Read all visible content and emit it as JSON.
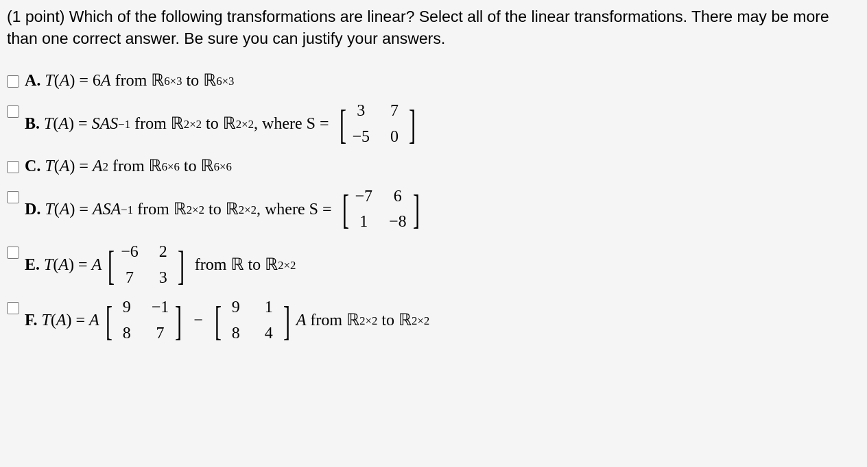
{
  "question": {
    "points_prefix": "(1 point) ",
    "text": "Which of the following transformations are linear? Select all of the linear transformations. There may be more than one correct answer. Be sure you can justify your answers."
  },
  "options": {
    "A": {
      "label": "A.",
      "eq_lhs": "T(A)",
      "eq_rhs": "6A",
      "from_space": "ℝ",
      "from_dim": "6×3",
      "to_space": "ℝ",
      "to_dim": "6×3"
    },
    "B": {
      "label": "B.",
      "eq_lhs": "T(A)",
      "eq_rhs": "SAS⁻¹",
      "from_dim": "2×2",
      "to_dim": "2×2",
      "where_label": ", where S",
      "matrix": {
        "r1c1": "3",
        "r1c2": "7",
        "r2c1": "−5",
        "r2c2": "0"
      }
    },
    "C": {
      "label": "C.",
      "eq_lhs": "T(A)",
      "eq_rhs": "A²",
      "from_dim": "6×6",
      "to_dim": "6×6"
    },
    "D": {
      "label": "D.",
      "eq_lhs": "T(A)",
      "eq_rhs": "ASA⁻¹",
      "from_dim": "2×2",
      "to_dim": "2×2",
      "where_label": ", where S",
      "matrix": {
        "r1c1": "−7",
        "r1c2": "6",
        "r2c1": "1",
        "r2c2": "−8"
      }
    },
    "E": {
      "label": "E.",
      "eq_lhs": "T(A)",
      "eq_rhs_prefix": "A",
      "matrix": {
        "r1c1": "−6",
        "r1c2": "2",
        "r2c1": "7",
        "r2c2": "3"
      },
      "from_label": "from ℝ to ",
      "to_dim": "2×2"
    },
    "F": {
      "label": "F.",
      "eq_lhs": "T(A)",
      "eq_rhs_prefix": "A",
      "matrix1": {
        "r1c1": "9",
        "r1c2": "−1",
        "r2c1": "8",
        "r2c2": "7"
      },
      "matrix2": {
        "r1c1": "9",
        "r1c2": "1",
        "r2c1": "8",
        "r2c2": "4"
      },
      "eq_rhs_suffix": "A",
      "from_dim": "2×2",
      "to_dim": "2×2"
    }
  },
  "words": {
    "from": "from",
    "to": "to",
    "eq": "=",
    "minus": "−"
  }
}
